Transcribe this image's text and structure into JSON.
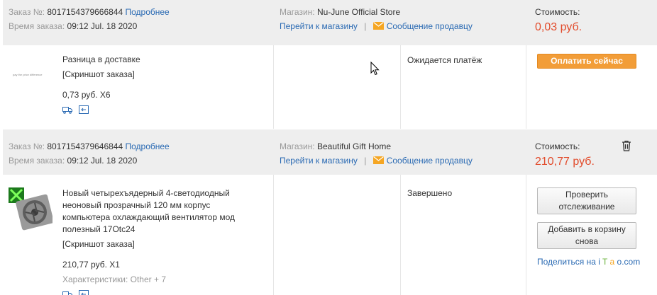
{
  "orders": [
    {
      "order_label": "Заказ №:",
      "order_number": "8017154379666844",
      "details_link": "Подробнее",
      "time_label": "Время заказа:",
      "time_value": "09:12 Jul. 18 2020",
      "store_label": "Магазин:",
      "store_name": "Nu-June Official Store",
      "go_to_store": "Перейти к магазину",
      "message_seller": "Сообщение продавцу",
      "cost_label": "Стоимость:",
      "cost_value": "0,03 руб.",
      "product": {
        "thumb_text": "pay the price difference",
        "title": "Разница в доставке",
        "snapshot": "[Скриншот заказа]",
        "price_qty": "0,73 руб. X6"
      },
      "status": "Ожидается платёж",
      "actions": {
        "pay_now": "Оплатить сейчас"
      }
    },
    {
      "order_label": "Заказ №:",
      "order_number": "8017154379646844",
      "details_link": "Подробнее",
      "time_label": "Время заказа:",
      "time_value": "09:12 Jul. 18 2020",
      "store_label": "Магазин:",
      "store_name": "Beautiful Gift Home",
      "go_to_store": "Перейти к магазину",
      "message_seller": "Сообщение продавцу",
      "cost_label": "Стоимость:",
      "cost_value": "210,77 руб.",
      "product": {
        "title": "Новый четырехъядерный 4-светодиодный неоновый прозрачный 120 мм корпус компьютера охлаждающий вентилятор мод полезный 17Otc24",
        "snapshot": "[Скриншот заказа]",
        "price_qty": "210,77 руб. X1",
        "attributes": "Характеристики: Other + 7"
      },
      "status": "Завершено",
      "actions": {
        "track": "Проверить отслеживание",
        "add_to_cart": "Добавить в корзину снова",
        "share_prefix": "Поделиться на ",
        "share_i": "i",
        "share_t": "T",
        "share_a": "a",
        "share_o": "o.com"
      }
    }
  ],
  "colors": {
    "header_bg": "#eeeeee",
    "link": "#2a6ab3",
    "price": "#e24b2b",
    "pay_button": "#f29d38"
  }
}
